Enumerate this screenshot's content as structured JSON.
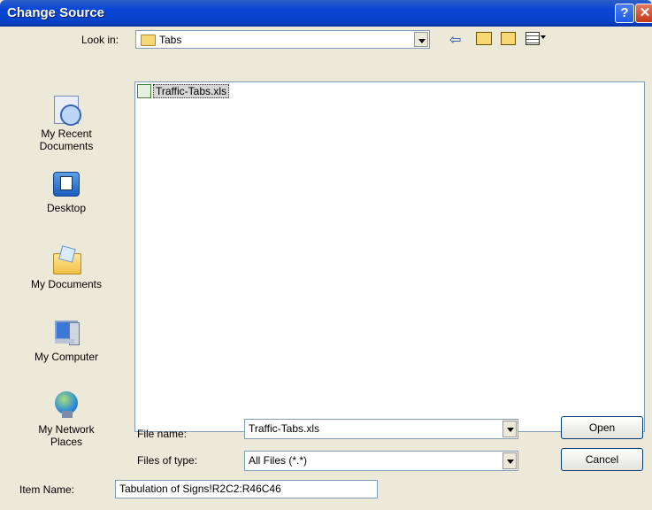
{
  "window": {
    "title": "Change Source",
    "help_label": "?",
    "close_label": "✕"
  },
  "lookin": {
    "label": "Look in:",
    "value": "Tabs"
  },
  "toolbar_icons": [
    "back-icon",
    "up-folder-icon",
    "new-folder-icon",
    "views-icon"
  ],
  "places": [
    {
      "name": "my-recent-documents",
      "label": "My Recent\nDocuments"
    },
    {
      "name": "desktop",
      "label": "Desktop"
    },
    {
      "name": "my-documents",
      "label": "My Documents"
    },
    {
      "name": "my-computer",
      "label": "My Computer"
    },
    {
      "name": "my-network-places",
      "label": "My Network\nPlaces"
    }
  ],
  "files": [
    {
      "name": "Traffic-Tabs.xls"
    }
  ],
  "filename": {
    "label": "File name:",
    "value": "Traffic-Tabs.xls"
  },
  "filetype": {
    "label": "Files of type:",
    "value": "All Files (*.*)"
  },
  "buttons": {
    "open": "Open",
    "cancel": "Cancel"
  },
  "item_name": {
    "label": "Item Name:",
    "value": "Tabulation of Signs!R2C2:R46C46"
  }
}
